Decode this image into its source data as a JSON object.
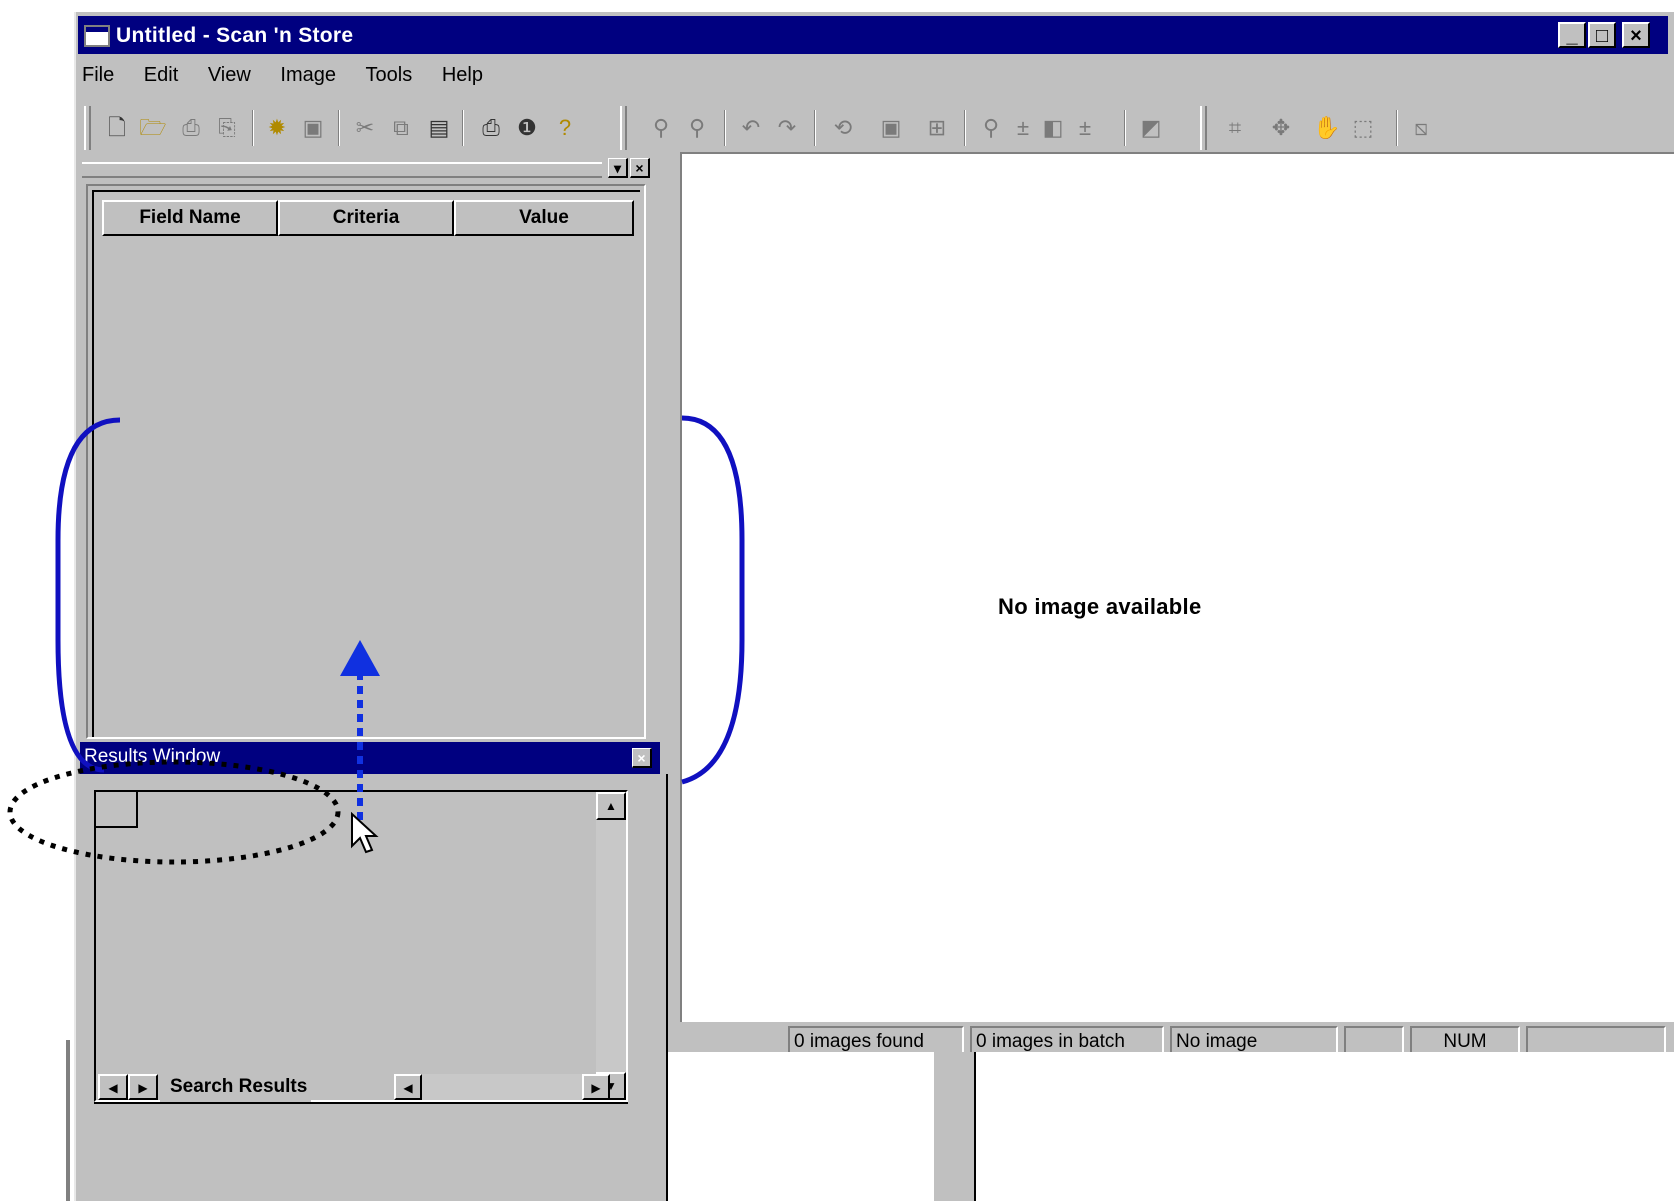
{
  "window": {
    "title": "Untitled - Scan 'n Store",
    "controls": [
      "_",
      "□",
      "×"
    ]
  },
  "menu": [
    {
      "label": "File"
    },
    {
      "label": "Edit"
    },
    {
      "label": "View"
    },
    {
      "label": "Image"
    },
    {
      "label": "Tools"
    },
    {
      "label": "Help"
    }
  ],
  "toolbar": {
    "icons": [
      "new-icon",
      "open-icon",
      "scan-icon",
      "scan-batch-icon",
      "acquire-icon",
      "save-icon",
      "cut-icon",
      "copy-icon",
      "paste-icon",
      "print-icon",
      "info-icon",
      "help-icon",
      "zoom-in-icon",
      "zoom-out-icon",
      "undo-icon",
      "redo-icon",
      "rotate-icon",
      "fit-page-icon",
      "fit-width-icon",
      "magnify-icon",
      "brightness-icon",
      "contrast-icon",
      "select-icon",
      "move-icon",
      "pan-icon",
      "marquee-icon",
      "annotate-icon"
    ]
  },
  "search_panel": {
    "columns": [
      "Field Name",
      "Criteria",
      "Value"
    ],
    "close_label": "×",
    "dock_label": "▾"
  },
  "image_area": {
    "message": "No image available"
  },
  "status": {
    "found": "0 images found",
    "batch": "0 images in batch",
    "image": "No image",
    "num": "NUM"
  },
  "results": {
    "title": "Results Window",
    "close_label": "×",
    "tab": "Search Results"
  },
  "colors": {
    "titlebar": "#000080",
    "face": "#c0c0c0",
    "annotation": "#0000cc"
  }
}
